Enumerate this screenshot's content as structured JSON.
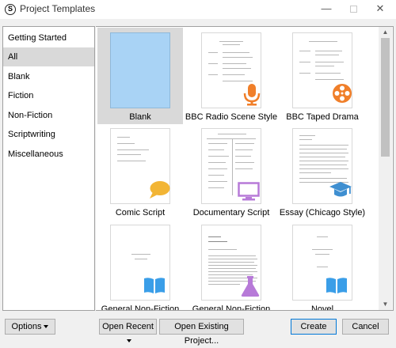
{
  "window": {
    "title": "Project Templates",
    "icon_letter": "S"
  },
  "categories": [
    {
      "label": "Getting Started",
      "selected": false
    },
    {
      "label": "All",
      "selected": true
    },
    {
      "label": "Blank",
      "selected": false
    },
    {
      "label": "Fiction",
      "selected": false
    },
    {
      "label": "Non-Fiction",
      "selected": false
    },
    {
      "label": "Scriptwriting",
      "selected": false
    },
    {
      "label": "Miscellaneous",
      "selected": false
    }
  ],
  "templates": [
    {
      "label": "Blank",
      "icon": "none",
      "selected": true
    },
    {
      "label": "BBC Radio Scene Style",
      "icon": "microphone-icon",
      "color": "#f07f2a"
    },
    {
      "label": "BBC Taped Drama",
      "icon": "film-reel-icon",
      "color": "#f07f2a"
    },
    {
      "label": "Comic Script",
      "icon": "speech-bubble-icon",
      "color": "#f2b535"
    },
    {
      "label": "Documentary Script",
      "icon": "monitor-icon",
      "color": "#b77ad8"
    },
    {
      "label": "Essay (Chicago Style)",
      "icon": "graduation-cap-icon",
      "color": "#3f8fd1"
    },
    {
      "label": "General Non-Fiction",
      "icon": "open-book-icon",
      "color": "#3a9ee8"
    },
    {
      "label": "General Non-Fiction",
      "icon": "flask-icon",
      "color": "#b77ad8"
    },
    {
      "label": "Novel",
      "icon": "open-book-icon",
      "color": "#3a9ee8"
    }
  ],
  "buttons": {
    "options": "Options",
    "open_recent": "Open Recent",
    "open_existing": "Open Existing Project...",
    "create": "Create",
    "cancel": "Cancel"
  },
  "colors": {
    "selection": "#d9d9d9",
    "blank_thumb": "#a9d3f5",
    "accent": "#0078d7"
  }
}
